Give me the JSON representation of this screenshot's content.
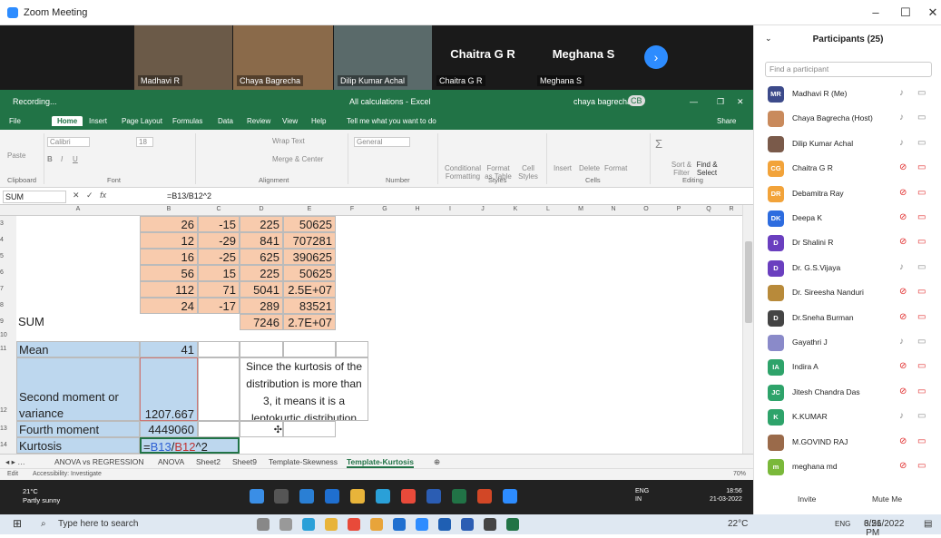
{
  "window": {
    "title": "Zoom Meeting"
  },
  "video": {
    "tiles": [
      {
        "name": "Madhavi R"
      },
      {
        "name": "Chaya Bagrecha"
      },
      {
        "name": "Dilip Kumar Achal"
      },
      {
        "name": "Chaitra G R",
        "display": "Chaitra G R"
      },
      {
        "name": "Meghana S",
        "display": "Meghana S"
      }
    ]
  },
  "excel": {
    "recording": "Recording...",
    "title": "All calculations - Excel",
    "user": "chaya bagrecha",
    "user_initials": "CB",
    "share": "Share",
    "menus": [
      "File",
      "Home",
      "Insert",
      "Page Layout",
      "Formulas",
      "Data",
      "Review",
      "View",
      "Help",
      "Tell me what you want to do"
    ],
    "ribbon": {
      "groups": [
        "Clipboard",
        "Font",
        "Alignment",
        "Number",
        "Styles",
        "Cells",
        "Editing"
      ],
      "font_name": "Calibri",
      "font_size": "18",
      "wrap": "Wrap Text",
      "merge": "Merge & Center",
      "number_fmt": "General",
      "cond": "Conditional Formatting",
      "fmt_table": "Format as Table",
      "cell_styles": "Cell Styles",
      "insert": "Insert",
      "delete": "Delete",
      "format": "Format",
      "sort": "Sort & Filter",
      "find": "Find & Select",
      "paste": "Paste"
    },
    "namebox": "SUM",
    "formula": "=B13/B12^2",
    "columns": [
      "A",
      "B",
      "C",
      "D",
      "E",
      "F",
      "G",
      "H",
      "I",
      "J",
      "K",
      "L",
      "M",
      "N",
      "O",
      "P",
      "Q",
      "R"
    ],
    "rows": [
      {
        "r": "3",
        "b": "26",
        "c": "-15",
        "d": "225",
        "e": "50625"
      },
      {
        "r": "4",
        "b": "12",
        "c": "-29",
        "d": "841",
        "e": "707281"
      },
      {
        "r": "5",
        "b": "16",
        "c": "-25",
        "d": "625",
        "e": "390625"
      },
      {
        "r": "6",
        "b": "56",
        "c": "15",
        "d": "225",
        "e": "50625"
      },
      {
        "r": "7",
        "b": "112",
        "c": "71",
        "d": "5041",
        "e": "2.5E+07"
      },
      {
        "r": "8",
        "b": "24",
        "c": "-17",
        "d": "289",
        "e": "83521"
      }
    ],
    "sum_row": {
      "r": "9",
      "a": "SUM",
      "d": "7246",
      "e": "2.7E+07"
    },
    "r10": "10",
    "mean": {
      "r": "11",
      "a": "Mean",
      "b": "41"
    },
    "second": {
      "r": "12",
      "a1": "Second moment or",
      "a2": "variance",
      "b": "1207.667"
    },
    "fourth": {
      "r": "13",
      "a": "Fourth moment",
      "b": "4449060"
    },
    "kurt": {
      "r": "14",
      "a": "Kurtosis",
      "b1": "=",
      "b2": "B13",
      "b3": "/",
      "b4": "B12",
      "b5": "^2"
    },
    "note": "Since the kurtosis of the distribution is more than 3, it means it is a leptokurtic distribution",
    "sheets": [
      "ANOVA vs REGRESSION",
      "ANOVA",
      "Sheet2",
      "Sheet9",
      "Template-Skewness",
      "Template-Kurtosis"
    ],
    "status": {
      "mode": "Edit",
      "access": "Accessibility: Investigate",
      "zoom": "70%"
    }
  },
  "taskbar_zoom": {
    "temp": "21°C",
    "cond": "Partly sunny",
    "lang1": "ENG",
    "lang2": "IN",
    "time": "18:56",
    "date": "21-03-2022"
  },
  "participants": {
    "title": "Participants (25)",
    "search_placeholder": "Find a participant",
    "list": [
      {
        "initials": "MR",
        "name": "Madhavi R (Me)",
        "color": "#3c4a8a",
        "muted": false
      },
      {
        "initials": "",
        "name": "Chaya Bagrecha (Host)",
        "color": "#c98a5c",
        "muted": false
      },
      {
        "initials": "",
        "name": "Dilip Kumar Achal",
        "color": "#7a5a4a",
        "muted": false
      },
      {
        "initials": "CG",
        "name": "Chaitra G R",
        "color": "#f2a33a",
        "muted": true
      },
      {
        "initials": "DR",
        "name": "Debamitra Ray",
        "color": "#f2a33a",
        "muted": true
      },
      {
        "initials": "DK",
        "name": "Deepa K",
        "color": "#2d6cdf",
        "muted": true
      },
      {
        "initials": "D",
        "name": "Dr Shalini R",
        "color": "#6a3fbf",
        "muted": true
      },
      {
        "initials": "D",
        "name": "Dr. G.S.Vijaya",
        "color": "#6a3fbf",
        "muted": false
      },
      {
        "initials": "",
        "name": "Dr. Sireesha Nanduri",
        "color": "#b88a3a",
        "muted": true
      },
      {
        "initials": "D",
        "name": "Dr.Sneha Burman",
        "color": "#444444",
        "muted": true
      },
      {
        "initials": "",
        "name": "Gayathri J",
        "color": "#8a8ac9",
        "muted": false
      },
      {
        "initials": "IA",
        "name": "Indira A",
        "color": "#2ea36a",
        "muted": true
      },
      {
        "initials": "JC",
        "name": "Jitesh Chandra Das",
        "color": "#2ea36a",
        "muted": true
      },
      {
        "initials": "K",
        "name": "K.KUMAR",
        "color": "#2ea36a",
        "muted": false
      },
      {
        "initials": "",
        "name": "M.GOVIND RAJ",
        "color": "#9a6a4a",
        "muted": true
      },
      {
        "initials": "m",
        "name": "meghana md",
        "color": "#7ab83a",
        "muted": true
      }
    ],
    "invite": "Invite",
    "mute": "Mute Me"
  },
  "win_taskbar": {
    "search": "Type here to search",
    "temp": "22°C",
    "lang": "ENG",
    "time": "6:56 PM",
    "date": "3/21/2022"
  }
}
